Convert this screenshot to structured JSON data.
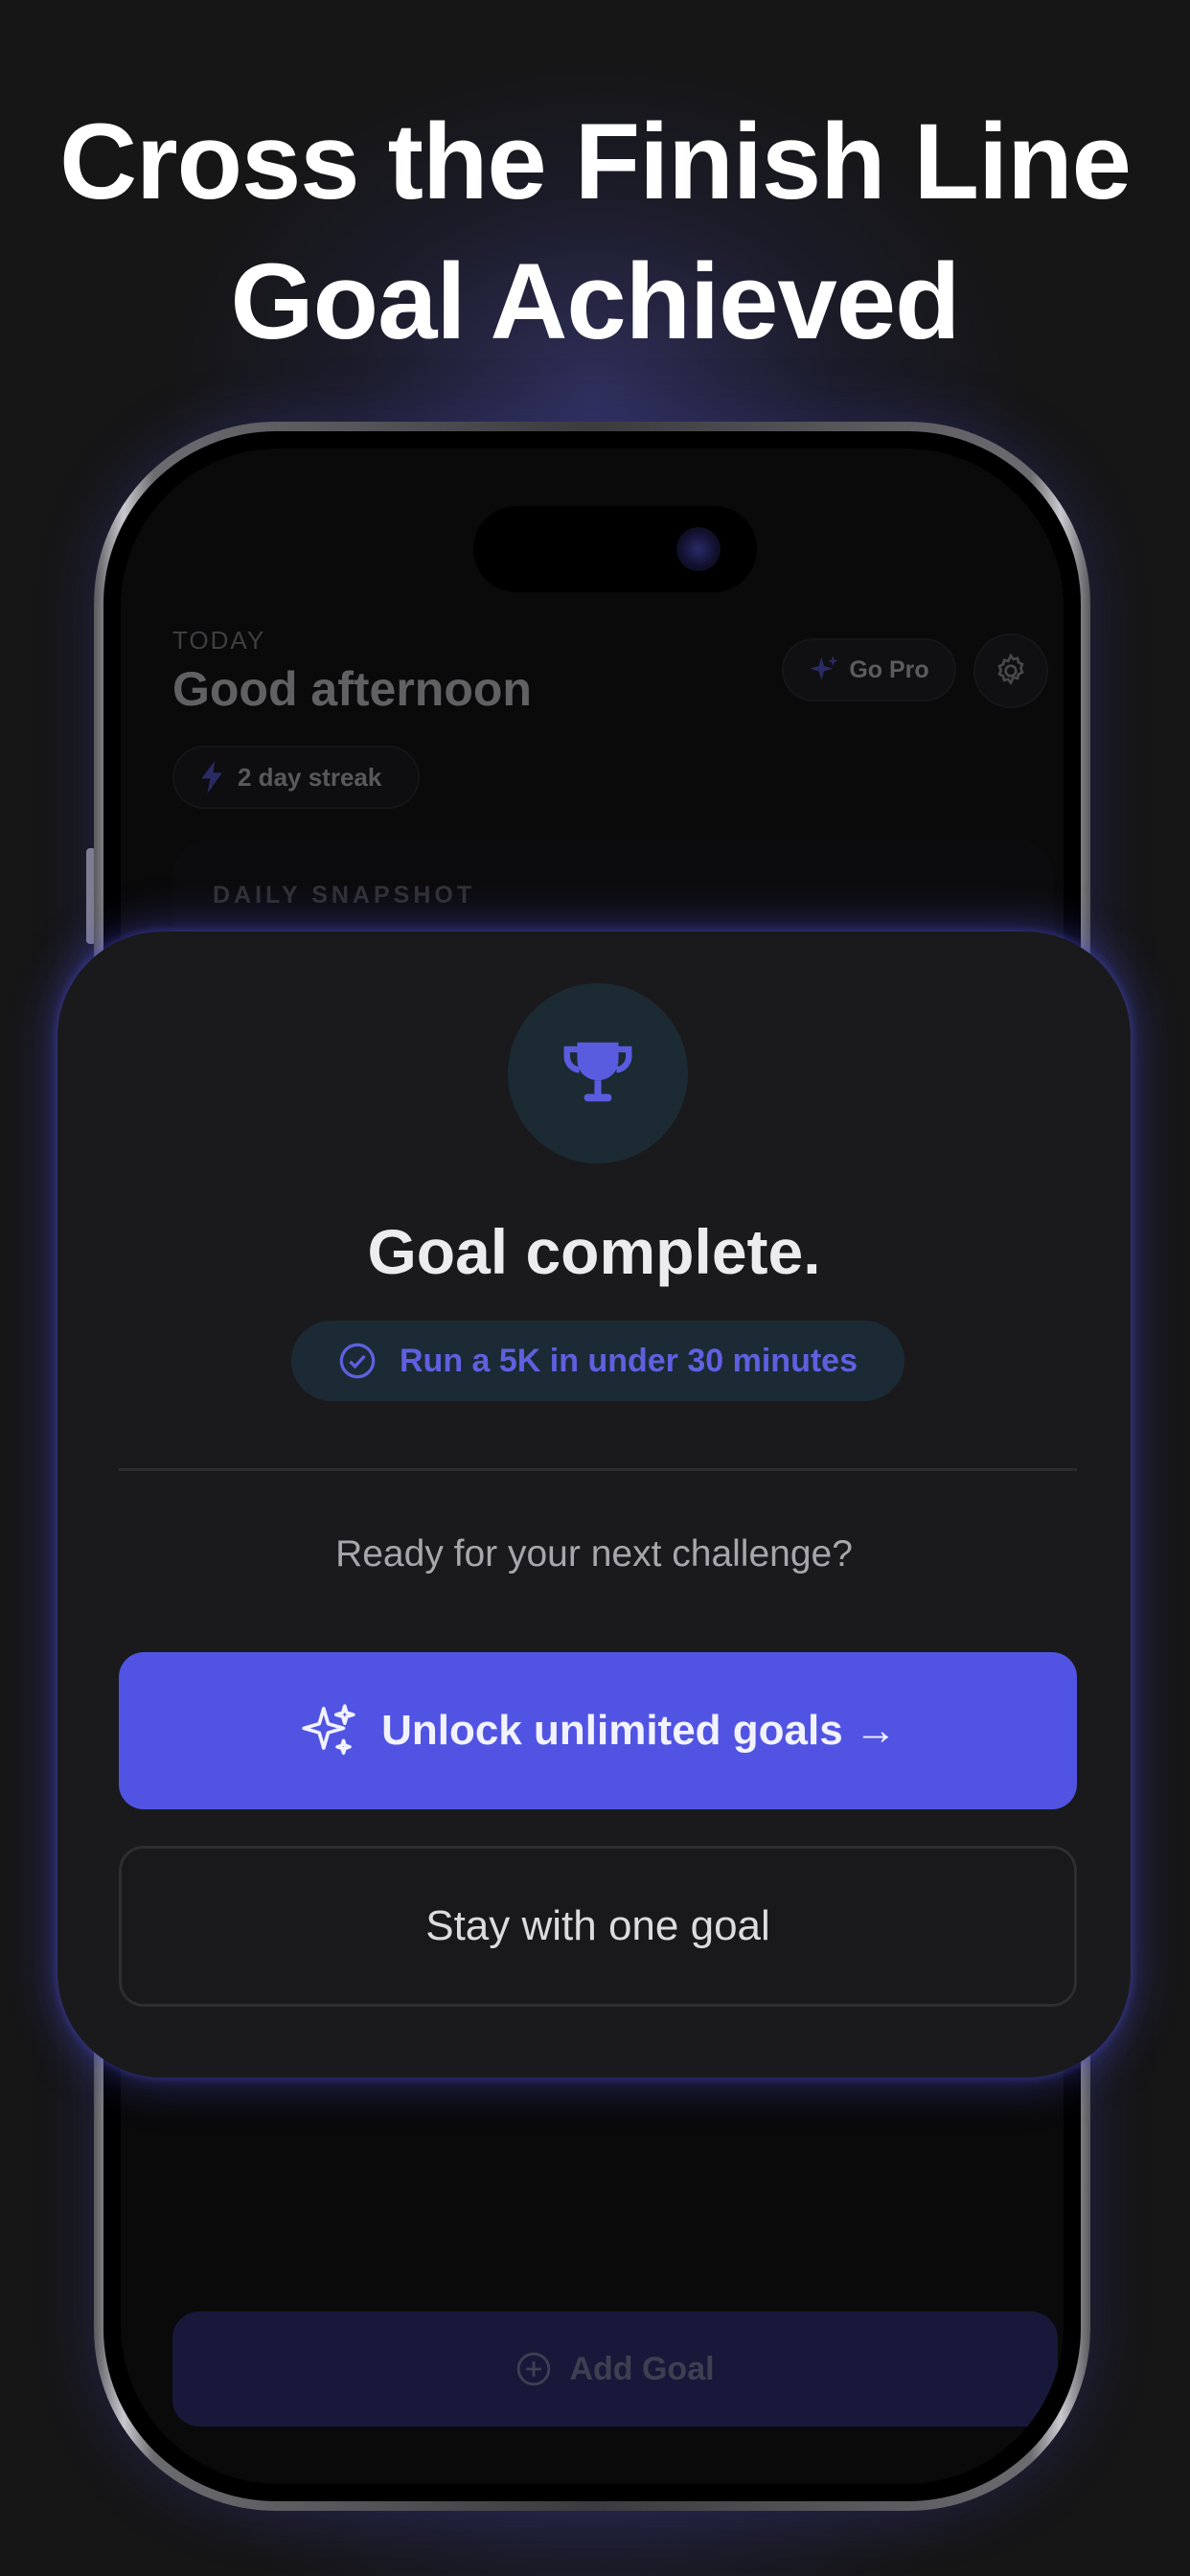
{
  "headline": {
    "line1": "Cross the Finish Line",
    "line2": "Goal Achieved"
  },
  "home": {
    "today_label": "TODAY",
    "greeting": "Good afternoon",
    "go_pro_label": "Go Pro",
    "streak_label": "2 day streak",
    "snapshot_label": "DAILY SNAPSHOT",
    "add_goal_label": "Add Goal"
  },
  "modal": {
    "title": "Goal complete.",
    "goal_name": "Run a 5K in under 30 minutes",
    "prompt": "Ready for your next challenge?",
    "primary_button": "Unlock unlimited goals →",
    "secondary_button": "Stay with one goal"
  },
  "colors": {
    "accent": "#5154e3",
    "background": "#161617",
    "modal_bg": "#1a1a1c",
    "goal_text": "#5f60e0"
  },
  "icons": [
    "trophy-icon",
    "check-circle-icon",
    "sparkles-icon",
    "gear-icon",
    "lightning-icon",
    "plus-circle-icon"
  ]
}
